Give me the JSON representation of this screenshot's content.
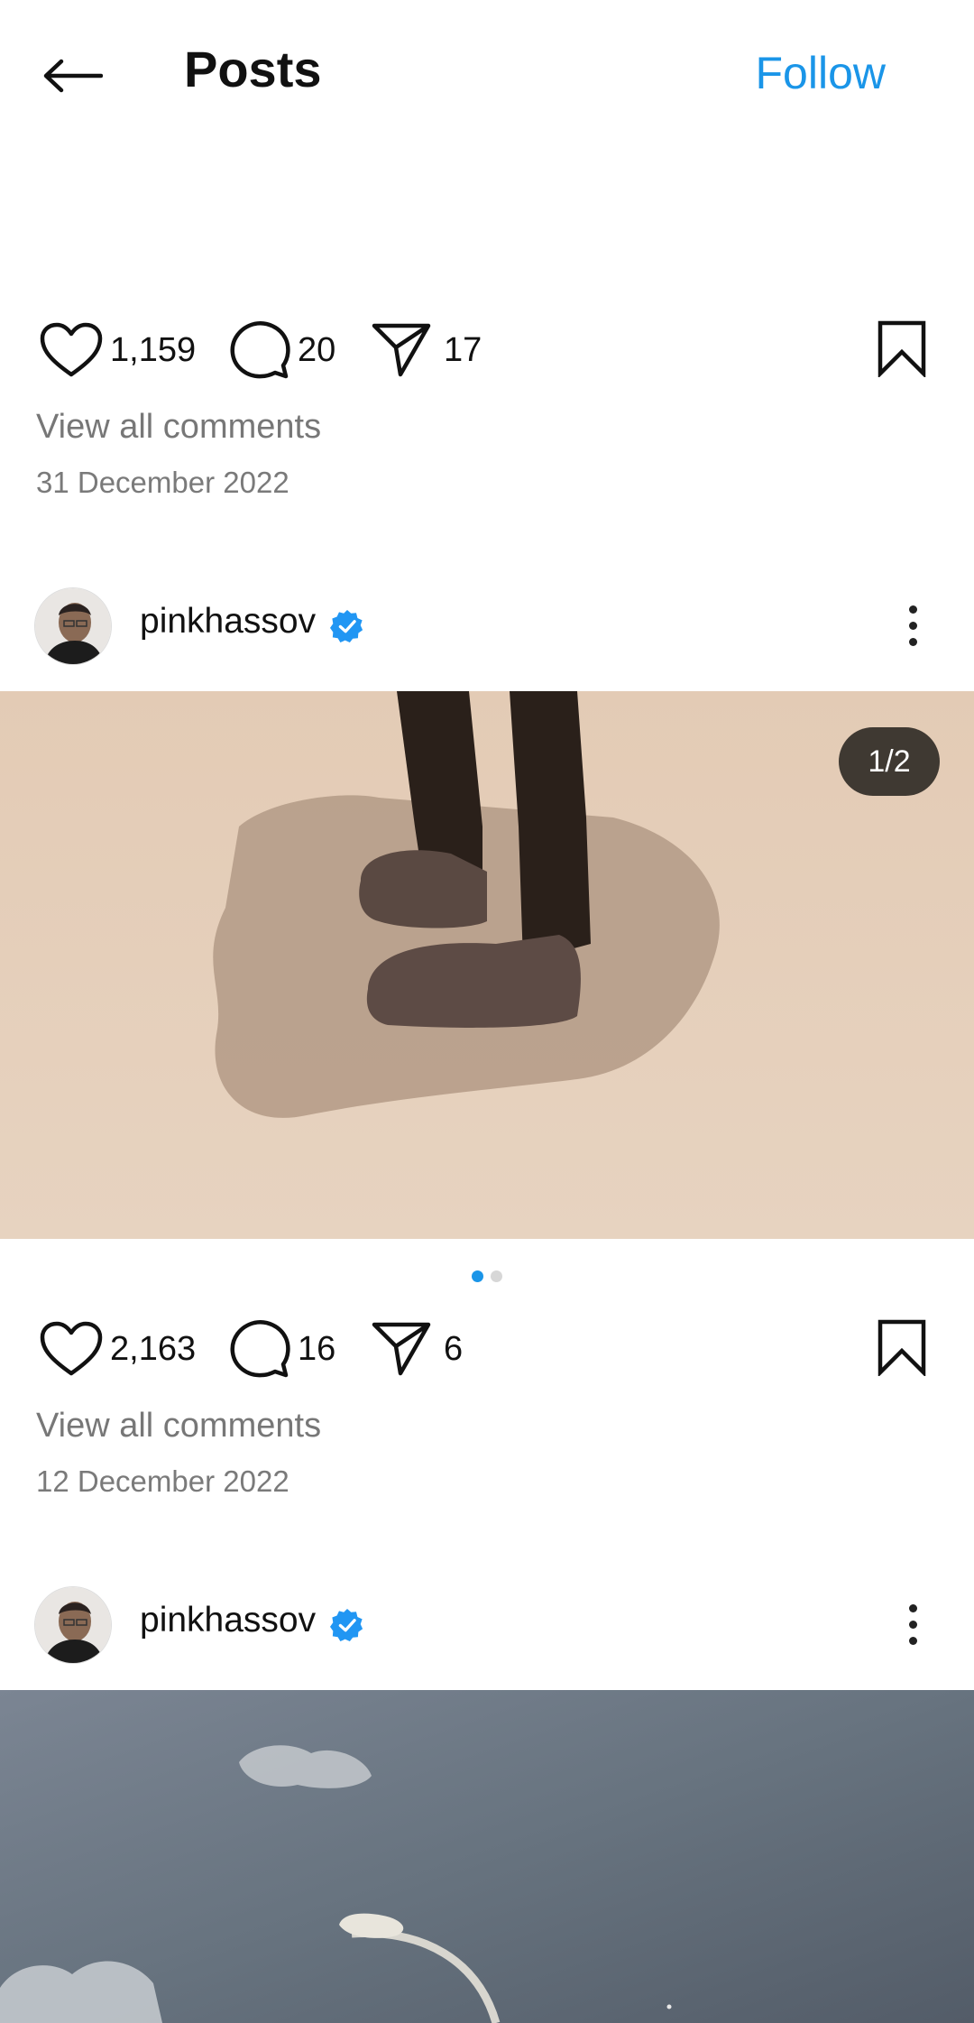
{
  "header": {
    "title": "Posts",
    "follow_label": "Follow"
  },
  "posts": [
    {
      "likes": "1,159",
      "comments": "20",
      "shares": "17",
      "view_comments": "View all comments",
      "date": "31 December 2022"
    },
    {
      "username": "pinkhassov",
      "verified": true,
      "image_counter": "1/2",
      "carousel_dots": 2,
      "active_dot": 0,
      "likes": "2,163",
      "comments": "16",
      "shares": "6",
      "view_comments": "View all comments",
      "date": "12 December 2022"
    },
    {
      "username": "pinkhassov",
      "verified": true
    }
  ],
  "colors": {
    "accent": "#1a95e8",
    "muted_text": "#777777",
    "badge_bg": "#2a2622"
  },
  "icons": [
    "back-arrow-icon",
    "heart-icon",
    "comment-icon",
    "share-icon",
    "bookmark-icon",
    "verified-badge-icon",
    "more-options-icon"
  ]
}
